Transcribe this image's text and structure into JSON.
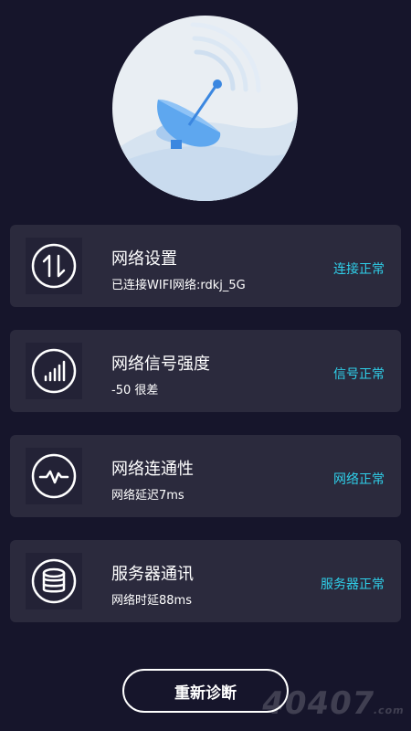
{
  "hero": {
    "icon": "satellite-dish-icon"
  },
  "cards": [
    {
      "title": "网络设置",
      "sub": "已连接WIFI网络:rdkj_5G",
      "status": "连接正常",
      "icon": "transfer-arrows-icon"
    },
    {
      "title": "网络信号强度",
      "sub": "-50 很差",
      "status": "信号正常",
      "icon": "signal-bars-icon"
    },
    {
      "title": "网络连通性",
      "sub": "网络延迟7ms",
      "status": "网络正常",
      "icon": "pulse-icon"
    },
    {
      "title": "服务器通讯",
      "sub": "网络时延88ms",
      "status": "服务器正常",
      "icon": "database-icon"
    }
  ],
  "button": {
    "label": "重新诊断"
  },
  "watermark": {
    "text": "4040",
    "suffix": "7",
    "domain": ".com"
  },
  "colors": {
    "background": "#16152b",
    "card": "#2b2a3d",
    "status": "#2fd0ea"
  }
}
